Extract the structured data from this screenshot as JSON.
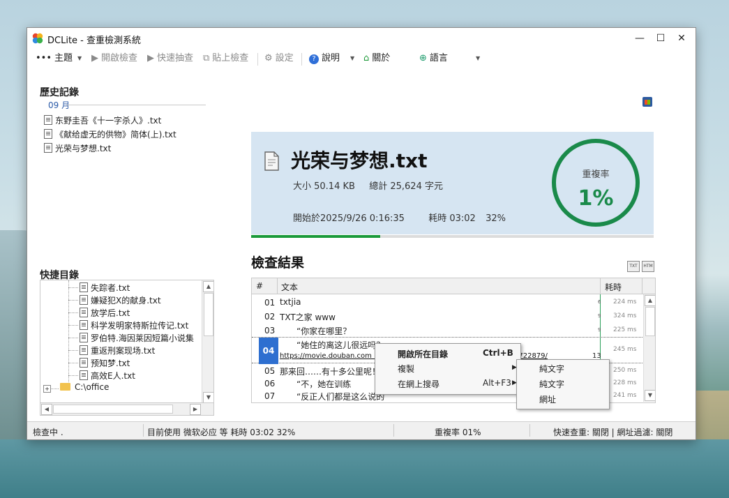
{
  "window": {
    "title": "DCLite - 查重檢測系統",
    "minimize": "—",
    "maximize": "☐",
    "close": "✕"
  },
  "toolbar": {
    "theme": "主題",
    "open_check": "開啟檢查",
    "quick_check": "快速抽查",
    "paste_check": "貼上檢查",
    "settings": "設定",
    "help": "說明",
    "about": "關於",
    "language": "語言"
  },
  "history": {
    "title": "歷史記錄",
    "month": "09 月",
    "items": [
      "东野圭吾《十一字杀人》.txt",
      "《献给虚无的供物》简体(上).txt",
      "光荣与梦想.txt"
    ]
  },
  "quick_dir": {
    "title": "快捷目錄",
    "items": [
      "失踪者.txt",
      "嫌疑犯X的献身.txt",
      "放学后.txt",
      "科学发明家特斯拉传记.txt",
      "罗伯特.海因莱因短篇小说集",
      "重返刑案现场.txt",
      "预知梦.txt",
      "高效E人.txt"
    ],
    "folder": "C:\\office"
  },
  "file_info": {
    "name": "光荣与梦想.txt",
    "size": "大小 50.14 KB",
    "total": "總計 25,624 字元",
    "started": "開始於2025/9/26 0:16:35",
    "elapsed": "耗時 03:02",
    "percent": "32%",
    "progress": 0.32,
    "rate_label": "重複率",
    "rate_value": "1%"
  },
  "results": {
    "title": "檢查結果",
    "col_num": "#",
    "col_text": "文本",
    "col_time": "耗時",
    "rows": [
      {
        "num": "01",
        "text": "txtjia",
        "mark": "6",
        "time": "224 ms"
      },
      {
        "num": "02",
        "text": "TXT之家 www",
        "mark": "9",
        "time": "324 ms"
      },
      {
        "num": "03",
        "text": "　　“你家在哪里？",
        "mark": "9",
        "time": "225 ms"
      },
      {
        "num": "04",
        "text": "　　“她住的离这儿很远吗？",
        "url": "https://movie.douban.com › s",
        "url_tail": "3722879/",
        "mark": "13",
        "time": "245 ms"
      },
      {
        "num": "05",
        "text": "那来回……有十多公里呢！",
        "mark": "",
        "time": "250 ms"
      },
      {
        "num": "06",
        "text": "　　“不，她在训练",
        "mark": "",
        "time": "228 ms"
      },
      {
        "num": "07",
        "text": "　　“反正人们都是这么说的",
        "mark": "",
        "time": "241 ms"
      }
    ]
  },
  "context_menu": {
    "open_dir": "開啟所在目錄",
    "open_dir_shortcut": "Ctrl+B",
    "copy": "複製",
    "search_web": "在網上搜尋",
    "search_web_shortcut": "Alt+F3",
    "sub_items": [
      "純文字",
      "純文字",
      "網址"
    ]
  },
  "status": {
    "state": "檢查中 .",
    "engine": "目前使用 微软必应 等 耗時 03:02   32%",
    "rate": "重複率 01%",
    "quick_query": "快速查重: 關閉 | 網址過濾: 關閉"
  },
  "colors": {
    "accent_green": "#1a8a4a",
    "panel_bg": "#d6e5f2",
    "selection_blue": "#2e6fd0"
  }
}
